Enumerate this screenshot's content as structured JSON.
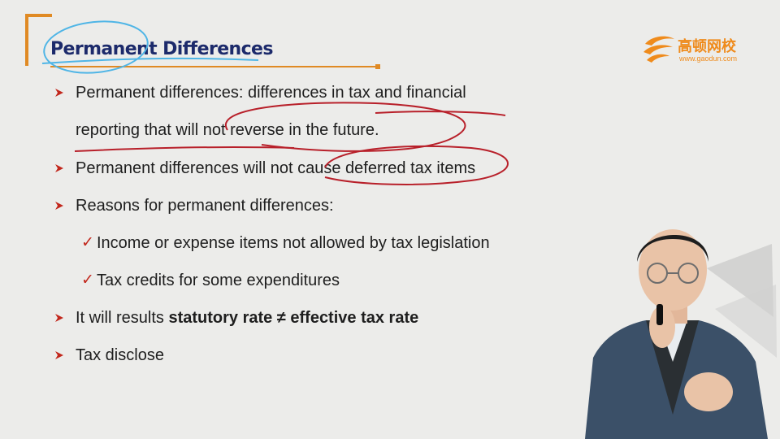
{
  "slide": {
    "title": "Permanent Differences",
    "logo": {
      "name": "高顿网校",
      "url": "www.gaodun.com"
    },
    "bullets": [
      {
        "line1": "Permanent differences: differences in tax and financial",
        "line2": "reporting that will not reverse in the future."
      },
      {
        "text": "Permanent differences will not cause deferred tax items"
      },
      {
        "text": "Reasons for permanent differences:"
      },
      {
        "text": "It will results ",
        "bold": "statutory rate ≠ effective tax rate"
      },
      {
        "text": "Tax disclose"
      }
    ],
    "subbullets": [
      {
        "text": "Income or expense items not allowed by tax legislation"
      },
      {
        "text": "Tax credits for some expenditures"
      }
    ]
  },
  "colors": {
    "title": "#1c2a6b",
    "accent_orange": "#e08a24",
    "bullet_red": "#c2271c",
    "annotation_red": "#b8202a",
    "annotation_blue": "#4fb5e6",
    "background": "#ececea"
  },
  "icons": {
    "bullet": "red-arrow-triangle-icon",
    "subbullet": "red-check-icon",
    "logo": "gaodun-swirl-logo-icon"
  }
}
